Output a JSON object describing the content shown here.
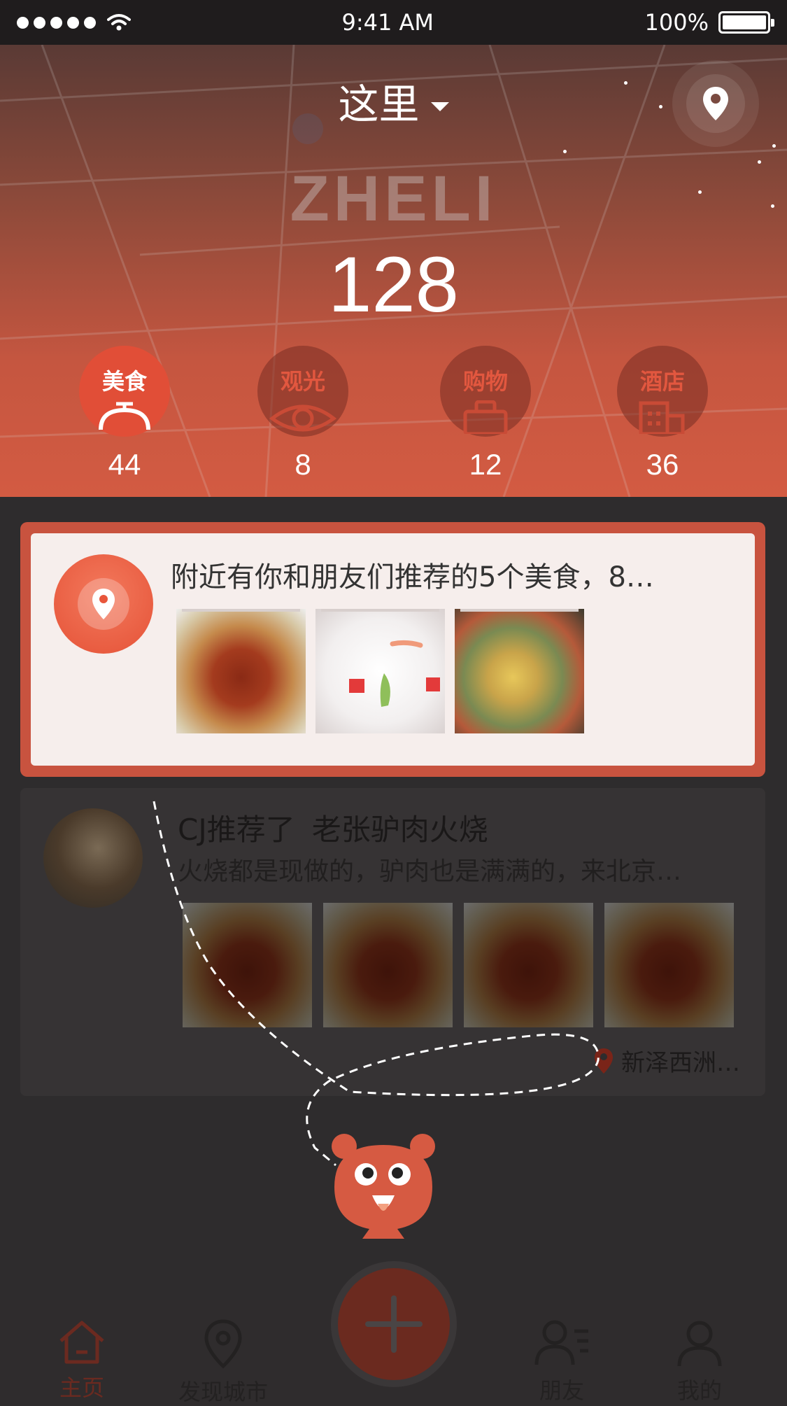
{
  "status_bar": {
    "time": "9:41 AM",
    "battery": "100%"
  },
  "header": {
    "location": "这里",
    "brand": "ZHELI",
    "total_count": "128",
    "categories": [
      {
        "label": "美食",
        "count": "44",
        "icon": "cloche-icon",
        "active": true
      },
      {
        "label": "观光",
        "count": "8",
        "icon": "eye-icon",
        "active": false
      },
      {
        "label": "购物",
        "count": "12",
        "icon": "shopping-bag-icon",
        "active": false
      },
      {
        "label": "酒店",
        "count": "36",
        "icon": "hotel-building-icon",
        "active": false
      }
    ]
  },
  "highlight": {
    "text": "附近有你和朋友们推荐的5个美食，8…"
  },
  "post": {
    "user": "CJ推荐了",
    "place": "老张驴肉火烧",
    "body": "火烧都是现做的，驴肉也是满满的，来北京…",
    "location": "新泽西洲…"
  },
  "tab_bar": {
    "tabs": [
      {
        "label": "主页",
        "icon": "home-icon",
        "active": true
      },
      {
        "label": "发现城市",
        "icon": "map-pin-icon",
        "active": false
      },
      {
        "label": "朋友",
        "icon": "friends-icon",
        "active": false
      },
      {
        "label": "我的",
        "icon": "profile-icon",
        "active": false
      }
    ],
    "fab_icon": "plus-icon"
  },
  "colors": {
    "accent": "#e14e37",
    "card_frame": "#c8533f",
    "overlay": "#2e2c2d"
  }
}
